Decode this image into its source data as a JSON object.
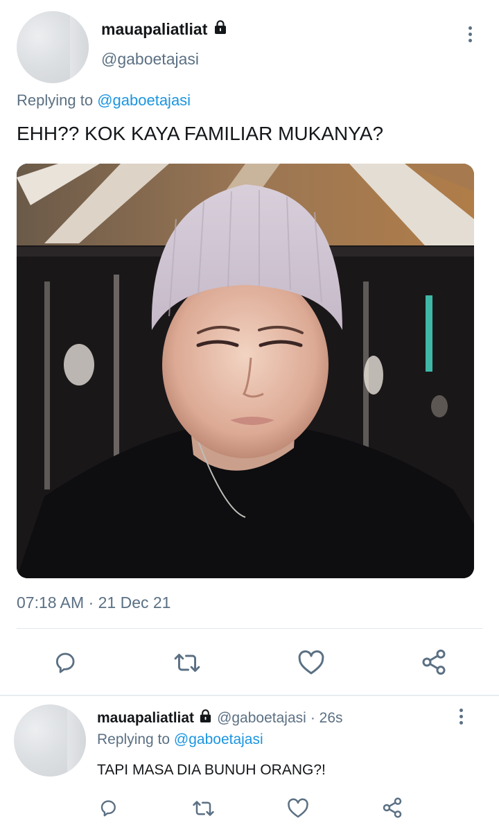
{
  "main_tweet": {
    "display_name": "mauapaliatliat",
    "handle": "@gaboetajasi",
    "replying_label": "Replying to",
    "replying_to": "@gaboetajasi",
    "text": "EHH?? KOK KAYA FAMILIAR MUKANYA?",
    "timestamp": "07:18 AM · 21 Dec 21",
    "actions": [
      "reply-icon",
      "retweet-icon",
      "like-icon",
      "share-icon"
    ]
  },
  "reply_tweet": {
    "display_name": "mauapaliatliat",
    "handle": "@gaboetajasi",
    "age": "· 26s",
    "replying_label": "Replying to",
    "replying_to": "@gaboetajasi",
    "text": "TAPI MASA DIA BUNUH ORANG?!",
    "actions": [
      "reply-icon",
      "retweet-icon",
      "like-icon",
      "share-icon"
    ]
  },
  "colors": {
    "link": "#1b95e0",
    "secondary_text": "#5b7083",
    "primary_text": "#14171a",
    "divider": "#e1e8ed"
  }
}
